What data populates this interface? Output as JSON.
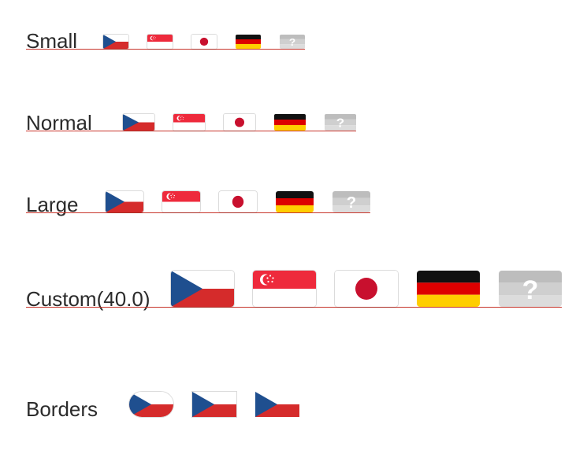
{
  "rows": [
    {
      "label": "Small",
      "flags": [
        "cz-icon",
        "sg-icon",
        "jp-icon",
        "de-icon",
        "unknown-icon"
      ]
    },
    {
      "label": "Normal",
      "flags": [
        "cz-icon",
        "sg-icon",
        "jp-icon",
        "de-icon",
        "unknown-icon"
      ]
    },
    {
      "label": "Large",
      "flags": [
        "cz-icon",
        "sg-icon",
        "jp-icon",
        "de-icon",
        "unknown-icon"
      ]
    },
    {
      "label": "Custom(40.0)",
      "flags": [
        "cz-icon",
        "sg-icon",
        "jp-icon",
        "de-icon",
        "unknown-icon"
      ]
    },
    {
      "label": "Borders",
      "flags": [
        "cz-icon",
        "cz-icon",
        "cz-icon"
      ]
    }
  ],
  "unknown_glyph": "?",
  "colors": {
    "underline": "#c8352c",
    "cz_blue": "#1f4f8f",
    "cz_red": "#d52b2b",
    "sg_red": "#ee2a3c",
    "jp_red": "#c8102e",
    "de_black": "#111111",
    "de_red": "#dd0000",
    "de_gold": "#ffce00",
    "unknown_gray": "#c9c9c9"
  }
}
